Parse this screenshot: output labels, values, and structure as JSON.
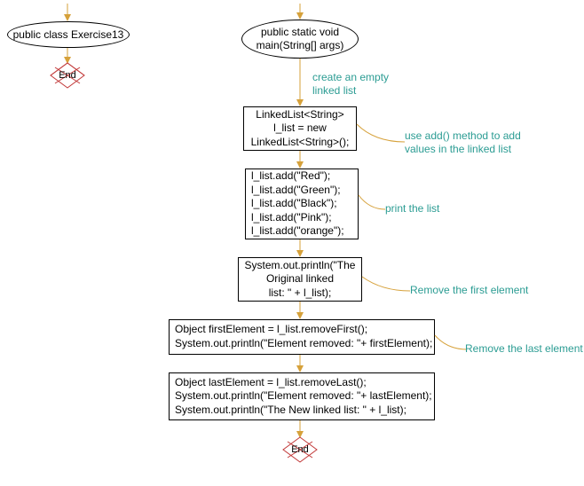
{
  "nodes": {
    "class_decl": "public class Exercise13",
    "end_left": "End",
    "main_decl": "public static void\nmain(String[] args)",
    "create_comment": "create an empty\nlinked list",
    "decl_list": "LinkedList<String>\nl_list = new\nLinkedList<String>();",
    "add_comment": "use add() method to add\nvalues in the linked list",
    "add_calls": "l_list.add(\"Red\");\nl_list.add(\"Green\");\nl_list.add(\"Black\");\nl_list.add(\"Pink\");\nl_list.add(\"orange\");",
    "print_comment": "print the list",
    "print_list": "System.out.println(\"The\nOriginal linked\nlist: \" + l_list);",
    "remove_first_comment": "Remove the first element",
    "remove_first": "Object firstElement = l_list.removeFirst();\nSystem.out.println(\"Element removed: \"+ firstElement);",
    "remove_last_comment": "Remove the last element",
    "remove_last": "Object lastElement = l_list.removeLast();\nSystem.out.println(\"Element removed: \"+ lastElement);\nSystem.out.println(\"The New linked list: \" + l_list);",
    "end_right": "End"
  },
  "colors": {
    "arrow": "#d6a13a",
    "end_stroke": "#c23a3a",
    "annot": "#2b9c93"
  }
}
